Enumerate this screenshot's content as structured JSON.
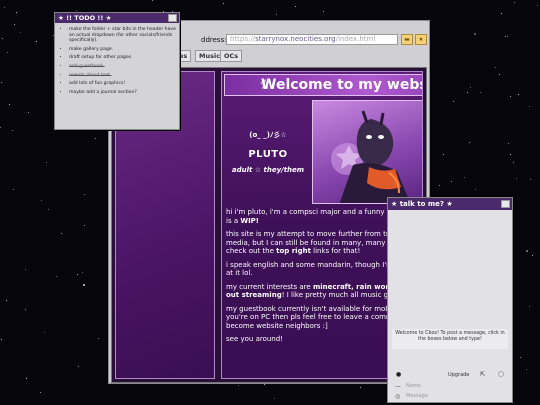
{
  "todo": {
    "title": "★ !! TODO !! ★",
    "items": [
      {
        "text": "make the folder + star bits in the header have an actual dropdown (for other socials/friends specifically).",
        "done": false
      },
      {
        "text": "make gallery page.",
        "done": false
      },
      {
        "text": "draft setup for other pages.",
        "done": false
      },
      {
        "text": "add guestbook.",
        "done": true
      },
      {
        "text": "rework about text.",
        "done": true
      },
      {
        "text": "add lots of fun graphics!",
        "done": false
      },
      {
        "text": "maybe add a journal section?",
        "done": false
      }
    ]
  },
  "browser": {
    "address_label": "ddress:",
    "url_prefix": "https://",
    "url_domain": "starrynox.neocities.org",
    "url_path": "/index.html",
    "tabs": [
      "es",
      "Music",
      "OCs"
    ]
  },
  "page": {
    "banner": "Welcome to my webs",
    "banner_star": "☆",
    "kaomoji": "(o_ _)ﾉ彡☆",
    "name": "PLUTO",
    "tagline": "adult ☆ they/them",
    "bio": [
      {
        "pre": "hi i'm pluto, i'm a compsci major and a funny little gi",
        "b": "",
        "post": ""
      },
      {
        "pre": "is a ",
        "b": "WIP!",
        "post": ""
      },
      {
        "pre": "this site is my attempt to move further from tradition",
        "b": "",
        "post": ""
      },
      {
        "pre": "media, but I can still be found in many, many places.",
        "b": "",
        "post": ""
      },
      {
        "pre": "check out the ",
        "b": "top right",
        "post": " links for that!"
      },
      {
        "pre": "i speak english and some mandarin, though I'm not s",
        "b": "",
        "post": ""
      },
      {
        "pre": "at it lol.",
        "b": "",
        "post": ""
      },
      {
        "pre": "my current interests are ",
        "b": "minecraft, rain world",
        "post": ", and"
      },
      {
        "pre": "",
        "b": "out streaming",
        "post": "! I like pretty much all music genres."
      },
      {
        "pre": "my guestbook currently isn't available for mobile, bu",
        "b": "",
        "post": ""
      },
      {
        "pre": "you're on PC then pls feel free to leave a comment ar",
        "b": "",
        "post": ""
      },
      {
        "pre": "become website neighbors :]",
        "b": "",
        "post": ""
      },
      {
        "pre": "see you around!",
        "b": "",
        "post": ""
      }
    ]
  },
  "chat": {
    "title": "★ talk to me? ★",
    "welcome": "Welcome to Cbox! To post a message, click in the boxes below and type!",
    "upgrade": "Upgrade",
    "name_placeholder": "Name",
    "message_placeholder": "Message"
  },
  "colors": {
    "window_title": "#4a2a6a",
    "page_purple": "#5a1c76",
    "banner_purple": "#b05ad0"
  }
}
